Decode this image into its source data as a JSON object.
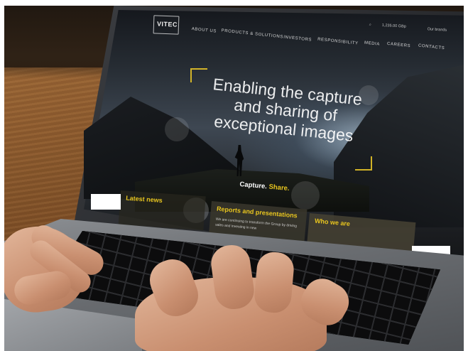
{
  "site": {
    "logo_text": "VITEC",
    "nav_items": [
      "ABOUT US",
      "PRODUCTS & SOLUTIONS",
      "INVESTORS",
      "RESPONSIBILITY",
      "MEDIA",
      "CAREERS",
      "CONTACTS"
    ],
    "share_price": "1,235.00 GBp",
    "our_brands": "Our brands",
    "hero_lines": [
      "Enabling the capture",
      "and sharing of",
      "exceptional images"
    ],
    "tagline_white": "Capture.",
    "tagline_accent": "Share.",
    "cards": {
      "latest_news": "Latest news",
      "reports": "Reports and presentations",
      "reports_body": "We are continuing to transform the Group by driving sales and investing in new",
      "who_we_are": "Who we are"
    }
  },
  "colors": {
    "accent_yellow": "#e8c51f",
    "screen_dark": "#15181d",
    "table_wood": "#8a5a30"
  }
}
